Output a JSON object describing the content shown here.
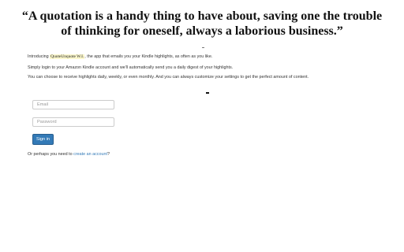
{
  "quote": {
    "text": "“A quotation is a handy thing to have about, saving one the trouble of thinking for oneself, always a laborious business.”"
  },
  "intro": {
    "line1_prefix": "Introducing",
    "brand": "QuoteUnquote W.I.",
    "line1_suffix": ", the app that emails you your Kindle highlights, as often as you like.",
    "line2": "Simply login to your Amazon Kindle account and we'll automatically send you a daily digest of your highlights.",
    "line3": "You can choose to receive highlights daily, weekly, or even monthly. And you can always customize your settings to get the perfect amount of content."
  },
  "login_form": {
    "email_placeholder": "Email",
    "password_placeholder": "Password",
    "signin_label": "Sign in"
  },
  "signup": {
    "prefix": "Or perhaps you need to",
    "link_text": "create an account",
    "suffix": "?"
  },
  "colors": {
    "accent": "#337ab7",
    "brand_highlight": "#fbf7cc"
  }
}
